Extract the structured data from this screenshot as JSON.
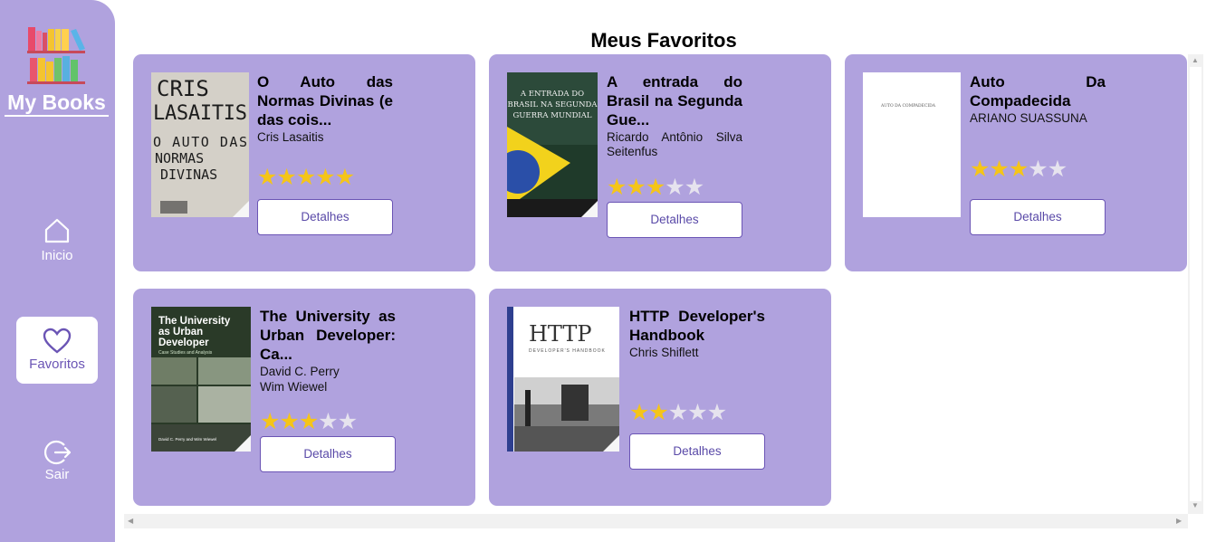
{
  "app": {
    "brand": "My Books",
    "page_title": "Meus Favoritos"
  },
  "nav": {
    "home": "Inicio",
    "favorites": "Favoritos",
    "logout": "Sair"
  },
  "colors": {
    "sidebar": "#b0a2de",
    "card": "#b0a2de",
    "accent": "#6b55b5",
    "star_on": "#f5c518",
    "star_off": "#e6e3ee"
  },
  "books": [
    {
      "title": "O Auto das Normas Divinas (e das cois...",
      "authors": [
        "Cris Lasaitis"
      ],
      "rating": 5,
      "button": "Detalhes",
      "cover_text": [
        "CRIS",
        "LASAITIS",
        "O AUTO DAS",
        "NORMAS",
        "DIVINAS"
      ]
    },
    {
      "title": "A entrada do Brasil na Segunda Gue...",
      "authors": [
        "Ricardo Antônio Silva Seitenfus"
      ],
      "rating": 3,
      "button": "Detalhes",
      "cover_text": [
        "A ENTRADA DO",
        "BRASIL NA SEGUNDA",
        "GUERRA MUNDIAL"
      ]
    },
    {
      "title": "Auto Da Compadecida",
      "authors": [
        "ARIANO SUASSUNA"
      ],
      "rating": 3,
      "button": "Detalhes",
      "cover_text": [
        "AUTO DA COMPADECIDA"
      ]
    },
    {
      "title": "The University as Urban Developer: Ca...",
      "authors": [
        "David C. Perry",
        "Wim Wiewel"
      ],
      "rating": 3,
      "button": "Detalhes",
      "cover_text": [
        "The University",
        "as Urban",
        "Developer",
        "Case Studies and Analysis",
        "David C. Perry and Wim Wiewel"
      ]
    },
    {
      "title": "HTTP Developer's Handbook",
      "authors": [
        "Chris Shiflett"
      ],
      "rating": 2,
      "button": "Detalhes",
      "cover_text": [
        "HTTP",
        "DEVELOPER'S HANDBOOK"
      ]
    }
  ]
}
